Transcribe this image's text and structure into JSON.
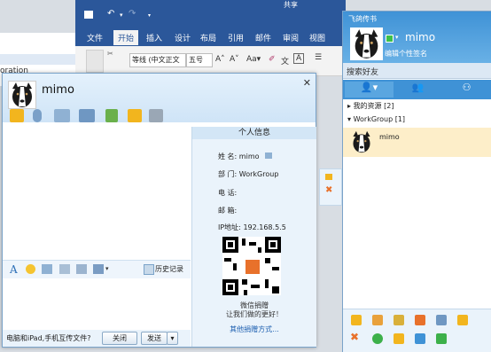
{
  "word": {
    "tabs": [
      "文件",
      "开始",
      "插入",
      "设计",
      "布局",
      "引用",
      "邮件",
      "审阅",
      "视图"
    ],
    "active_tab": "开始",
    "font_name": "等线 (中文正文",
    "font_size": "五号",
    "top_right": "共享"
  },
  "left_doc": {
    "text": "oration"
  },
  "chat": {
    "contact_name": "mimo",
    "info_title": "个人信息",
    "info_rows": [
      {
        "label": "姓 名:",
        "value": "mimo"
      },
      {
        "label": "部 门:",
        "value": "WorkGroup"
      },
      {
        "label": "电 话:",
        "value": ""
      },
      {
        "label": "邮 箱:",
        "value": ""
      },
      {
        "label": "IP地址:",
        "value": "192.168.5.5"
      }
    ],
    "qr_caption1": "微信捐赠",
    "qr_caption2": "让我们做的更好！",
    "other_donate": "其他捐赠方式...",
    "history": "历史记录",
    "footer_text": "电脑和iPad,手机互传文件?",
    "close_button": "关闭",
    "send_button": "发送"
  },
  "contacts": {
    "app_title": "飞鸽传书",
    "user_name": "mimo",
    "signature": "编辑个性签名",
    "search_placeholder": "搜索好友",
    "groups": [
      {
        "name": "我的资源 [2]",
        "expanded": false
      },
      {
        "name": "WorkGroup [1]",
        "expanded": true
      }
    ],
    "contact": "mimo"
  },
  "colors": {
    "word_blue": "#2b579a",
    "accent": "#3f92d6"
  }
}
